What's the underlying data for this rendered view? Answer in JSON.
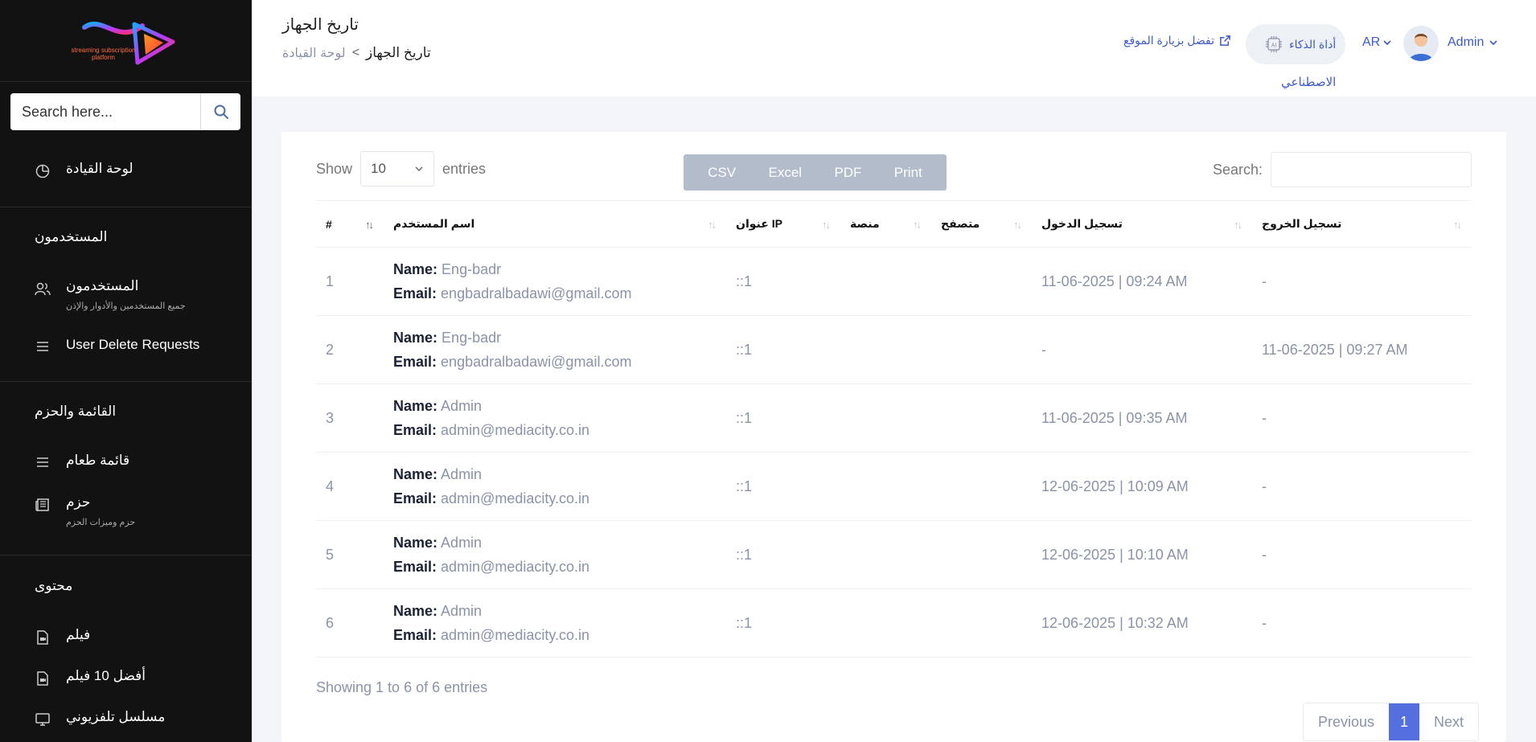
{
  "sidebar": {
    "logo_text": "streaming subscription platform",
    "search_placeholder": "Search here...",
    "dashboard": "لوحة القيادة",
    "users_section": "المستخدمون",
    "users_item": "المستخدمون",
    "users_sub": "جميع المستخدمين والأدوار والإذن",
    "delete_requests": "User Delete Requests",
    "menus_section": "القائمة والحزم",
    "menu_item": "قائمة طعام",
    "packages_item": "حزم",
    "packages_sub": "حزم وميزات الحزم",
    "content_section": "محتوى",
    "movie_item": "فيلم",
    "top10_item": "أفضل 10 فيلم",
    "tv_item": "مسلسل تلفزيوني"
  },
  "header": {
    "title": "تاريخ الجهاز",
    "breadcrumb_home": "لوحة القيادة",
    "breadcrumb_sep": "<",
    "breadcrumb_current": "تاريخ الجهاز",
    "visit_site": "تفضل بزيارة الموقع",
    "ai_tool_line1": "أداة الذكاء",
    "ai_tool_line2": "الاصطناعي",
    "lang": "AR",
    "user": "Admin"
  },
  "table_controls": {
    "show": "Show",
    "entries_value": "10",
    "entries": "entries",
    "buttons": [
      "CSV",
      "Excel",
      "PDF",
      "Print"
    ],
    "search_label": "Search:"
  },
  "table": {
    "columns": [
      "#",
      "اسم المستخدم",
      "عنوان IP",
      "منصة",
      "متصفح",
      "تسجيل الدخول",
      "تسجيل الخروج"
    ],
    "name_label": "Name:",
    "email_label": "Email:",
    "rows": [
      {
        "num": "1",
        "name": "Eng-badr",
        "email": "engbadralbadawi@gmail.com",
        "ip": "::1",
        "platform": "",
        "browser": "",
        "login": "11-06-2025 | 09:24 AM",
        "logout": "-"
      },
      {
        "num": "2",
        "name": "Eng-badr",
        "email": "engbadralbadawi@gmail.com",
        "ip": "::1",
        "platform": "",
        "browser": "",
        "login": "-",
        "logout": "11-06-2025 | 09:27 AM"
      },
      {
        "num": "3",
        "name": "Admin",
        "email": "admin@mediacity.co.in",
        "ip": "::1",
        "platform": "",
        "browser": "",
        "login": "11-06-2025 | 09:35 AM",
        "logout": "-"
      },
      {
        "num": "4",
        "name": "Admin",
        "email": "admin@mediacity.co.in",
        "ip": "::1",
        "platform": "",
        "browser": "",
        "login": "12-06-2025 | 10:09 AM",
        "logout": "-"
      },
      {
        "num": "5",
        "name": "Admin",
        "email": "admin@mediacity.co.in",
        "ip": "::1",
        "platform": "",
        "browser": "",
        "login": "12-06-2025 | 10:10 AM",
        "logout": "-"
      },
      {
        "num": "6",
        "name": "Admin",
        "email": "admin@mediacity.co.in",
        "ip": "::1",
        "platform": "",
        "browser": "",
        "login": "12-06-2025 | 10:32 AM",
        "logout": "-"
      }
    ]
  },
  "footer": {
    "info": "Showing 1 to 6 of 6 entries",
    "previous": "Previous",
    "page": "1",
    "next": "Next"
  },
  "colors": {
    "sidebar_bg": "#121212",
    "accent": "#3d5ac6",
    "page_active": "#5470e0",
    "export_buttons": "#b2bcca"
  }
}
